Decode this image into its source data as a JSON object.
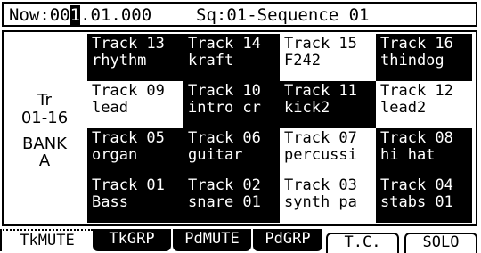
{
  "status": {
    "now_label": "Now:",
    "now_prefix": "00",
    "now_cursor": "1",
    "now_suffix": ".01.000",
    "seq": "Sq:01-Sequence 01"
  },
  "bank": {
    "line1": "Tr",
    "line2": "01-16",
    "line3": "BANK",
    "line4": "A"
  },
  "tracks": [
    {
      "title": "Track 13",
      "name": "rhythm",
      "on": true
    },
    {
      "title": "Track 14",
      "name": "kraft",
      "on": true
    },
    {
      "title": "Track 15",
      "name": "F242",
      "on": false
    },
    {
      "title": "Track 16",
      "name": "thindog",
      "on": true
    },
    {
      "title": "Track 09",
      "name": "lead",
      "on": false
    },
    {
      "title": "Track 10",
      "name": "intro cr",
      "on": true
    },
    {
      "title": "Track 11",
      "name": "kick2",
      "on": true
    },
    {
      "title": "Track 12",
      "name": "lead2",
      "on": false
    },
    {
      "title": "Track 05",
      "name": "organ",
      "on": true
    },
    {
      "title": "Track 06",
      "name": "guitar",
      "on": true
    },
    {
      "title": "Track 07",
      "name": "percussi",
      "on": false
    },
    {
      "title": "Track 08",
      "name": "hi hat",
      "on": true
    },
    {
      "title": "Track 01",
      "name": "Bass",
      "on": true
    },
    {
      "title": "Track 02",
      "name": "snare 01",
      "on": true
    },
    {
      "title": "Track 03",
      "name": "synth pa",
      "on": false
    },
    {
      "title": "Track 04",
      "name": "stabs 01",
      "on": true
    }
  ],
  "tabs": {
    "tkmute": "TkMUTE",
    "tkgrp": "TkGRP",
    "pdmute": "PdMUTE",
    "pdgrp": "PdGRP",
    "tc": "T.C.",
    "solo": "SOLO"
  }
}
